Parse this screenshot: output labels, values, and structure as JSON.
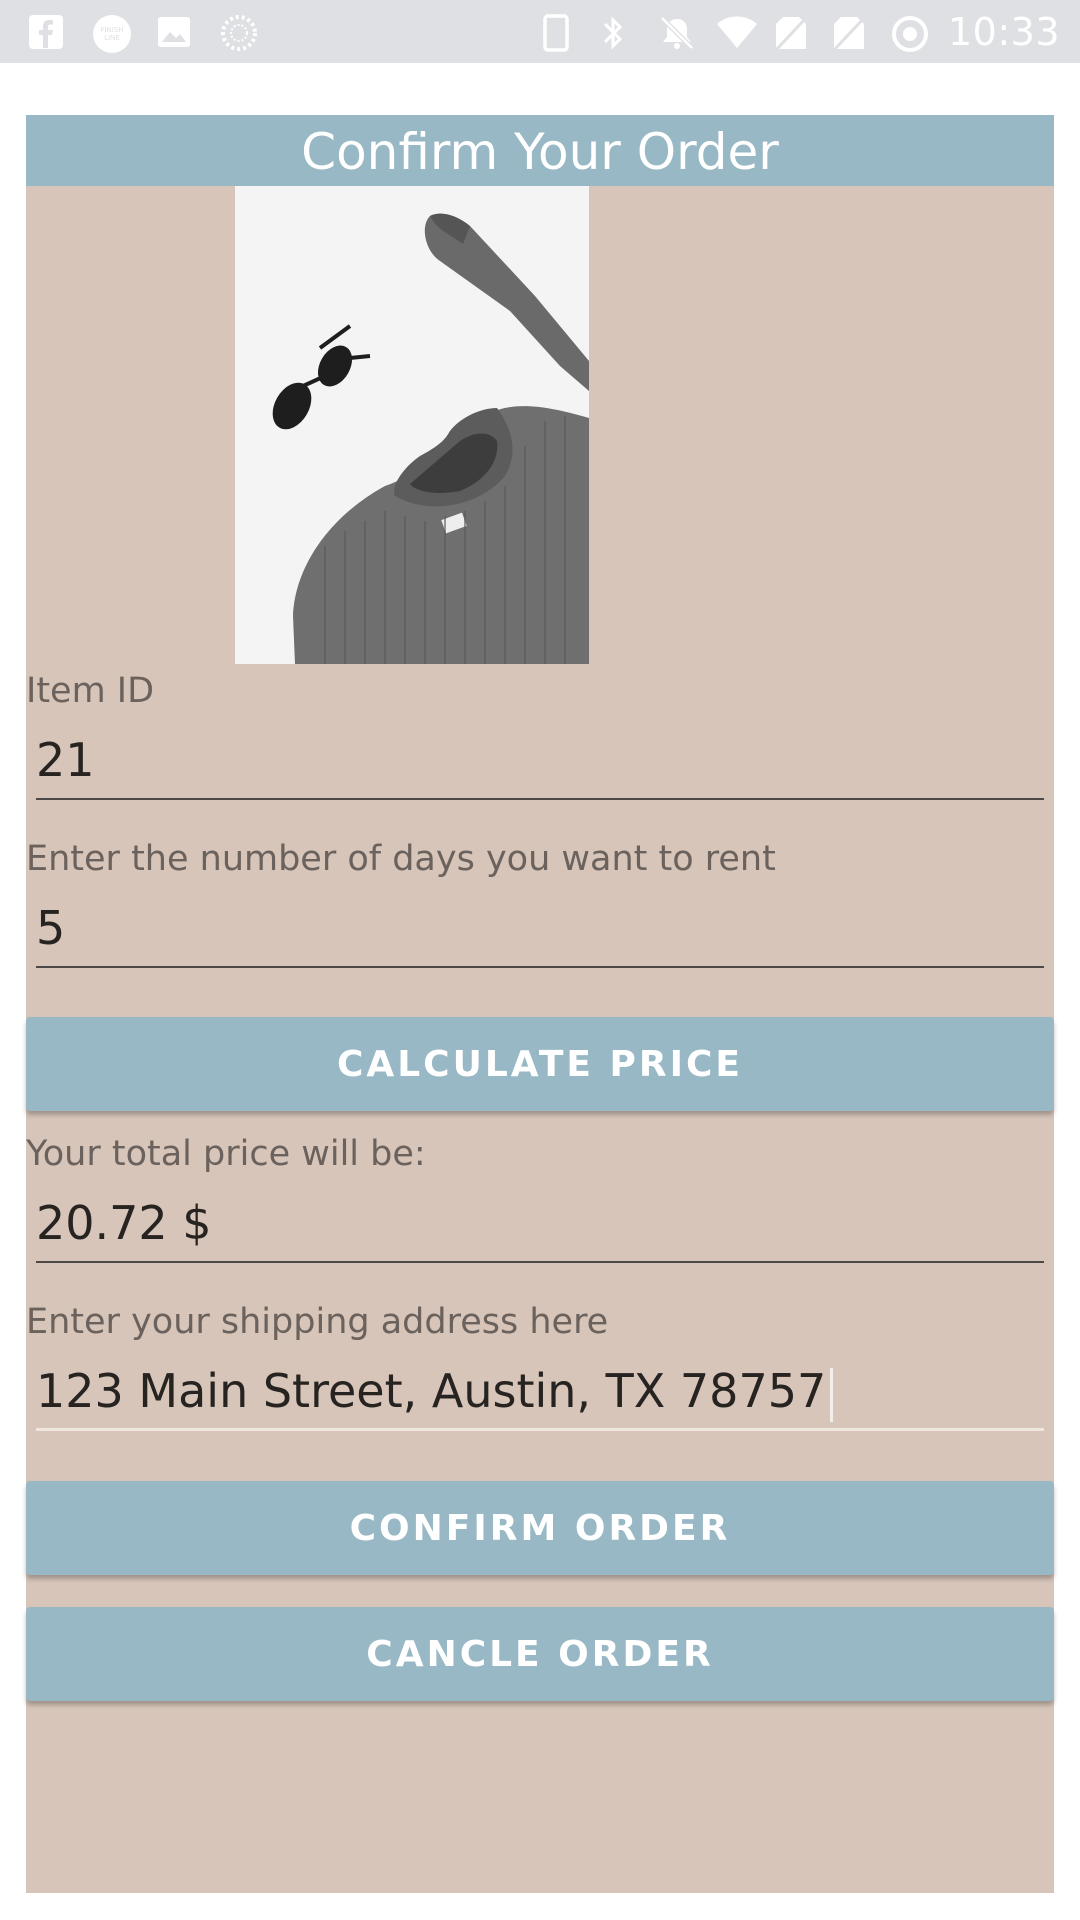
{
  "status_bar": {
    "time": "10:33",
    "left_icons": [
      "facebook-icon",
      "finish-line-icon",
      "image-icon",
      "loading-icon"
    ],
    "right_icons": [
      "phone-icon",
      "bluetooth-icon",
      "mute-icon",
      "wifi-icon",
      "no-sim-icon",
      "no-sim-icon",
      "sync-icon"
    ]
  },
  "page": {
    "title": "Confirm Your Order",
    "image_alt": "gray knit sweater with sunglasses"
  },
  "form": {
    "item_id_label": "Item ID",
    "item_id_value": "21",
    "days_label": "Enter the number of days you want to rent",
    "days_value": "5",
    "calculate_button": "CALCULATE PRICE",
    "price_label": "Your total price will be:",
    "price_value": "20.72 $",
    "address_label": "Enter your shipping address here",
    "address_value": "123 Main Street, Austin, TX 78757",
    "confirm_button": "CONFIRM ORDER",
    "cancel_button": "CANCLE ORDER"
  },
  "colors": {
    "accent": "#97b8c4",
    "background": "#d7c5b9",
    "status_bar": "#dfe0e3"
  }
}
